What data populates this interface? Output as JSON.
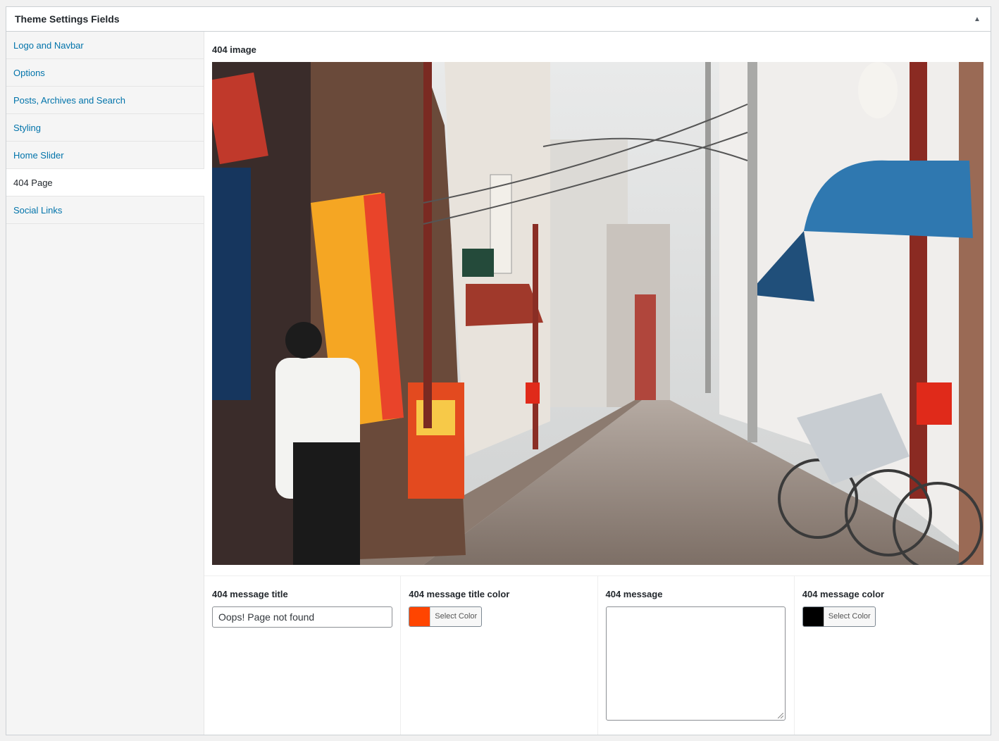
{
  "metabox": {
    "title": "Theme Settings Fields"
  },
  "tabs": [
    {
      "label": "Logo and Navbar",
      "active": false
    },
    {
      "label": "Options",
      "active": false
    },
    {
      "label": "Posts, Archives and Search",
      "active": false
    },
    {
      "label": "Styling",
      "active": false
    },
    {
      "label": "Home Slider",
      "active": false
    },
    {
      "label": "404 Page",
      "active": true
    },
    {
      "label": "Social Links",
      "active": false
    }
  ],
  "image_field": {
    "label": "404 image"
  },
  "fields": {
    "title": {
      "label": "404 message title",
      "value": "Oops! Page not found"
    },
    "title_color": {
      "label": "404 message title color",
      "button": "Select Color",
      "color": "#ff4500"
    },
    "message": {
      "label": "404 message",
      "value": ""
    },
    "message_color": {
      "label": "404 message color",
      "button": "Select Color",
      "color": "#000000"
    }
  },
  "colors": {
    "link": "#0073aa",
    "border": "#ccd0d4"
  }
}
